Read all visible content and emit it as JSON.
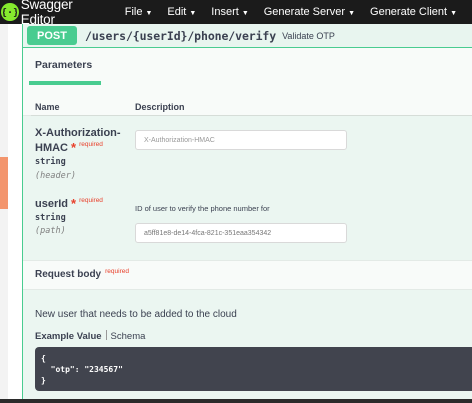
{
  "topbar": {
    "app_title": "Swagger Editor",
    "menu": [
      {
        "label": "File"
      },
      {
        "label": "Edit"
      },
      {
        "label": "Insert"
      },
      {
        "label": "Generate Server"
      },
      {
        "label": "Generate Client"
      }
    ],
    "caret": "▼"
  },
  "operation": {
    "method": "POST",
    "path": "/users/{userId}/phone/verify",
    "summary": "Validate OTP"
  },
  "parameters": {
    "tab_label": "Parameters",
    "col_name": "Name",
    "col_description": "Description",
    "required_mark": "*",
    "required_text": "required",
    "items": [
      {
        "name_line1": "X-Authorization-",
        "name_line2": "HMAC",
        "type": "string",
        "in": "(header)",
        "description": "",
        "placeholder": "X-Authorization-HMAC"
      },
      {
        "name_line1": "userId",
        "name_line2": "",
        "type": "string",
        "in": "(path)",
        "description": "ID of user to verify the phone number for",
        "value": "a5ff81e8-de14-4fca-821c-351eaa354342"
      }
    ]
  },
  "request_body": {
    "title": "Request body",
    "required_text": "required",
    "description": "New user that needs to be added to the cloud",
    "example_tab": "Example Value",
    "schema_tab": "Schema",
    "example_code": "{\n  \"otp\": \"234567\"\n}"
  },
  "colors": {
    "post_green": "#49cc90",
    "topbar": "#1b1b1b",
    "logo_green": "#85ea2d",
    "required_red": "#e8402b"
  }
}
